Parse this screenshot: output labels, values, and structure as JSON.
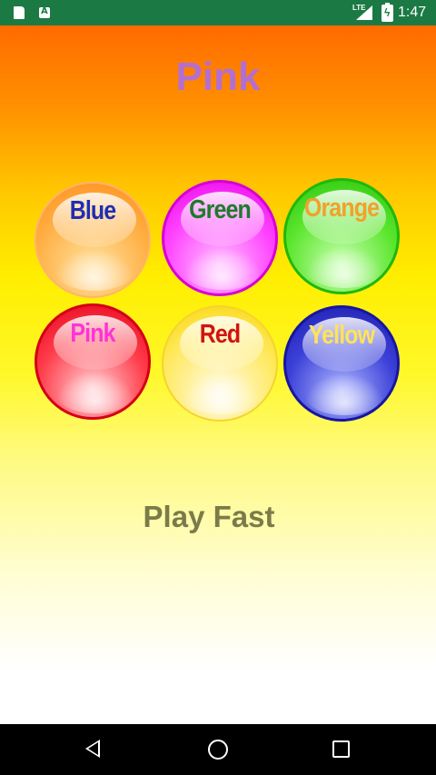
{
  "status_bar": {
    "network_label": "LTE",
    "time": "1:47",
    "icons": [
      "sd-card-icon",
      "app-a-icon",
      "signal-icon",
      "battery-charging-icon"
    ]
  },
  "game": {
    "target_color": "Pink",
    "balls": [
      {
        "label": "Blue",
        "label_color": "#1f2eb0",
        "ball_color": "#ff9a2e"
      },
      {
        "label": "Green",
        "label_color": "#1e7a2a",
        "ball_color": "#ff33ff"
      },
      {
        "label": "Orange",
        "label_color": "#f2a12a",
        "ball_color": "#3dd61c"
      },
      {
        "label": "Pink",
        "label_color": "#ff33d6",
        "ball_color": "#f01426"
      },
      {
        "label": "Red",
        "label_color": "#d01414",
        "ball_color": "#ffe640"
      },
      {
        "label": "Yellow",
        "label_color": "#ffe35a",
        "ball_color": "#2b2fc8"
      }
    ],
    "play_button": "Play Fast"
  },
  "nav_bar": {
    "icons": [
      "back-icon",
      "home-icon",
      "recents-icon"
    ]
  }
}
